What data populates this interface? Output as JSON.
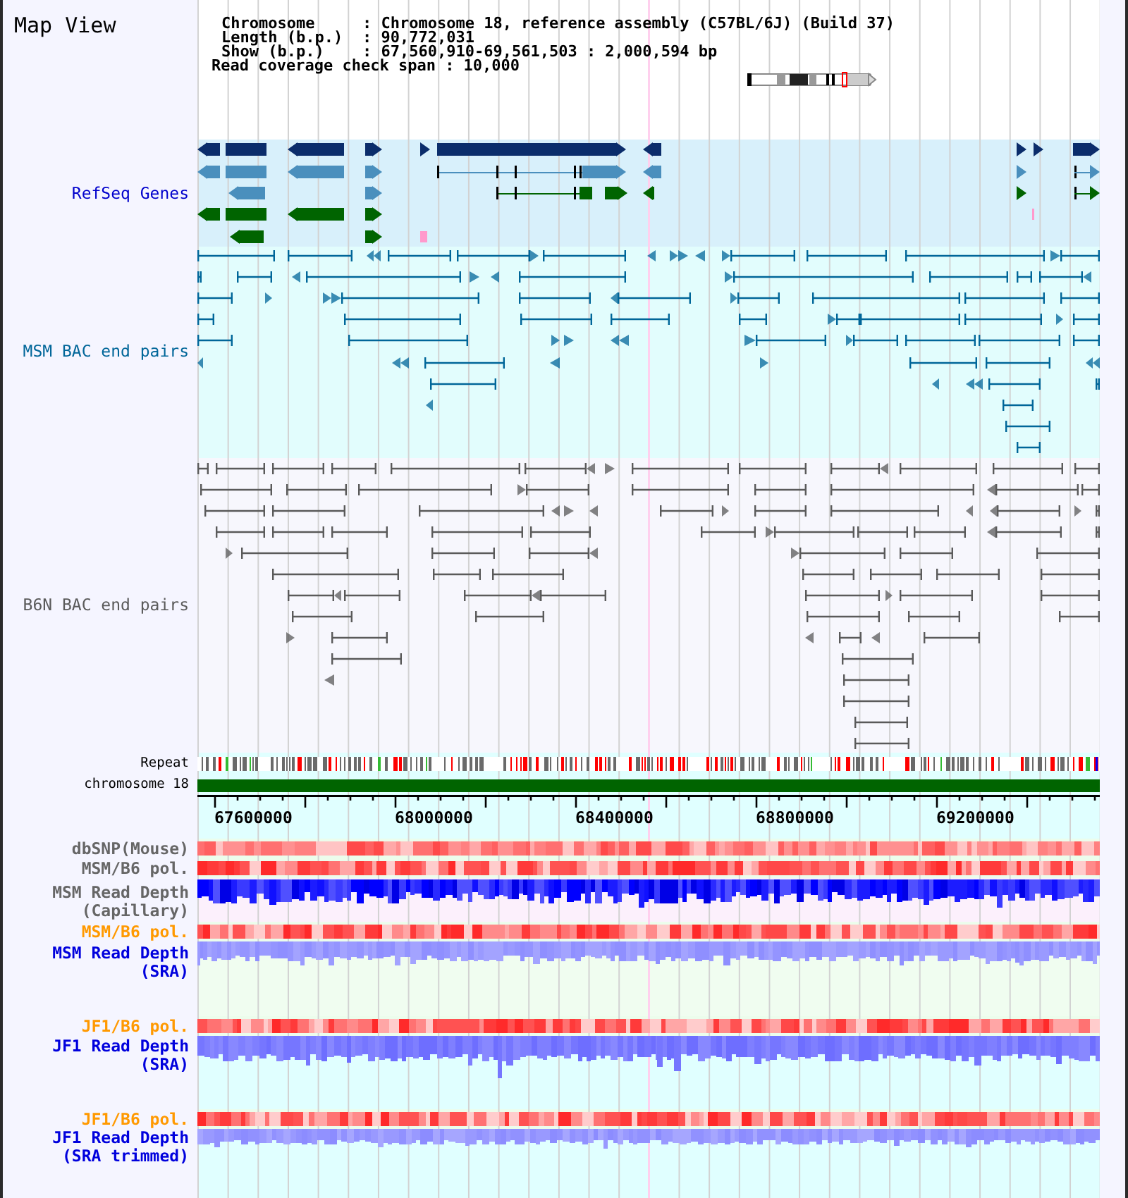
{
  "panel_title": "Map View",
  "info": {
    "rows": [
      {
        "label": "Chromosome",
        "value": ": Chromosome 18, reference assembly (C57BL/6J) (Build 37)"
      },
      {
        "label": "Length (b.p.)",
        "value": ": 90,772,031"
      },
      {
        "label": "Show (b.p.)",
        "value": ": 67,560,910-69,561,503 : 2,000,594 bp"
      }
    ],
    "coverage_span": "Read coverage check span : 10,000"
  },
  "tracks": [
    {
      "kind": "genes",
      "label": "RefSeq Genes",
      "color": "#0000cc"
    },
    {
      "kind": "msm-bac",
      "label": "MSM BAC end pairs",
      "color": "#006699"
    },
    {
      "kind": "b6n-bac",
      "label": "B6N BAC end pairs",
      "color": "#5a5a5a"
    },
    {
      "kind": "repeat",
      "label": "Repeat",
      "color": "#000000"
    },
    {
      "kind": "chromosome",
      "label": "chromosome 18",
      "color": "#000000"
    },
    {
      "kind": "axis",
      "ticks": [
        "67600000",
        "68000000",
        "68400000",
        "68800000",
        "69200000"
      ]
    },
    {
      "kind": "snp",
      "label": "dbSNP(Mouse)",
      "color": "#666666"
    },
    {
      "kind": "pol",
      "label": "MSM/B6 pol.",
      "color": "#666666"
    },
    {
      "kind": "capillary-depth",
      "label": "MSM Read Depth\n(Capillary)",
      "color": "#666666"
    },
    {
      "kind": "pol",
      "label": "MSM/B6 pol.",
      "color": "#ff9900"
    },
    {
      "kind": "msm-sra-depth",
      "label": "MSM Read Depth\n(SRA)",
      "color": "#0000dd"
    },
    {
      "kind": "pol",
      "label": "JF1/B6 pol.",
      "color": "#ff9900"
    },
    {
      "kind": "jf1-sra-depth",
      "label": "JF1 Read Depth\n(SRA)",
      "color": "#0000dd"
    },
    {
      "kind": "pol",
      "label": "JF1/B6 pol.",
      "color": "#ff9900"
    },
    {
      "kind": "trimmed-depth",
      "label": "JF1 Read Depth\n(SRA trimmed)",
      "color": "#0000dd"
    }
  ]
}
